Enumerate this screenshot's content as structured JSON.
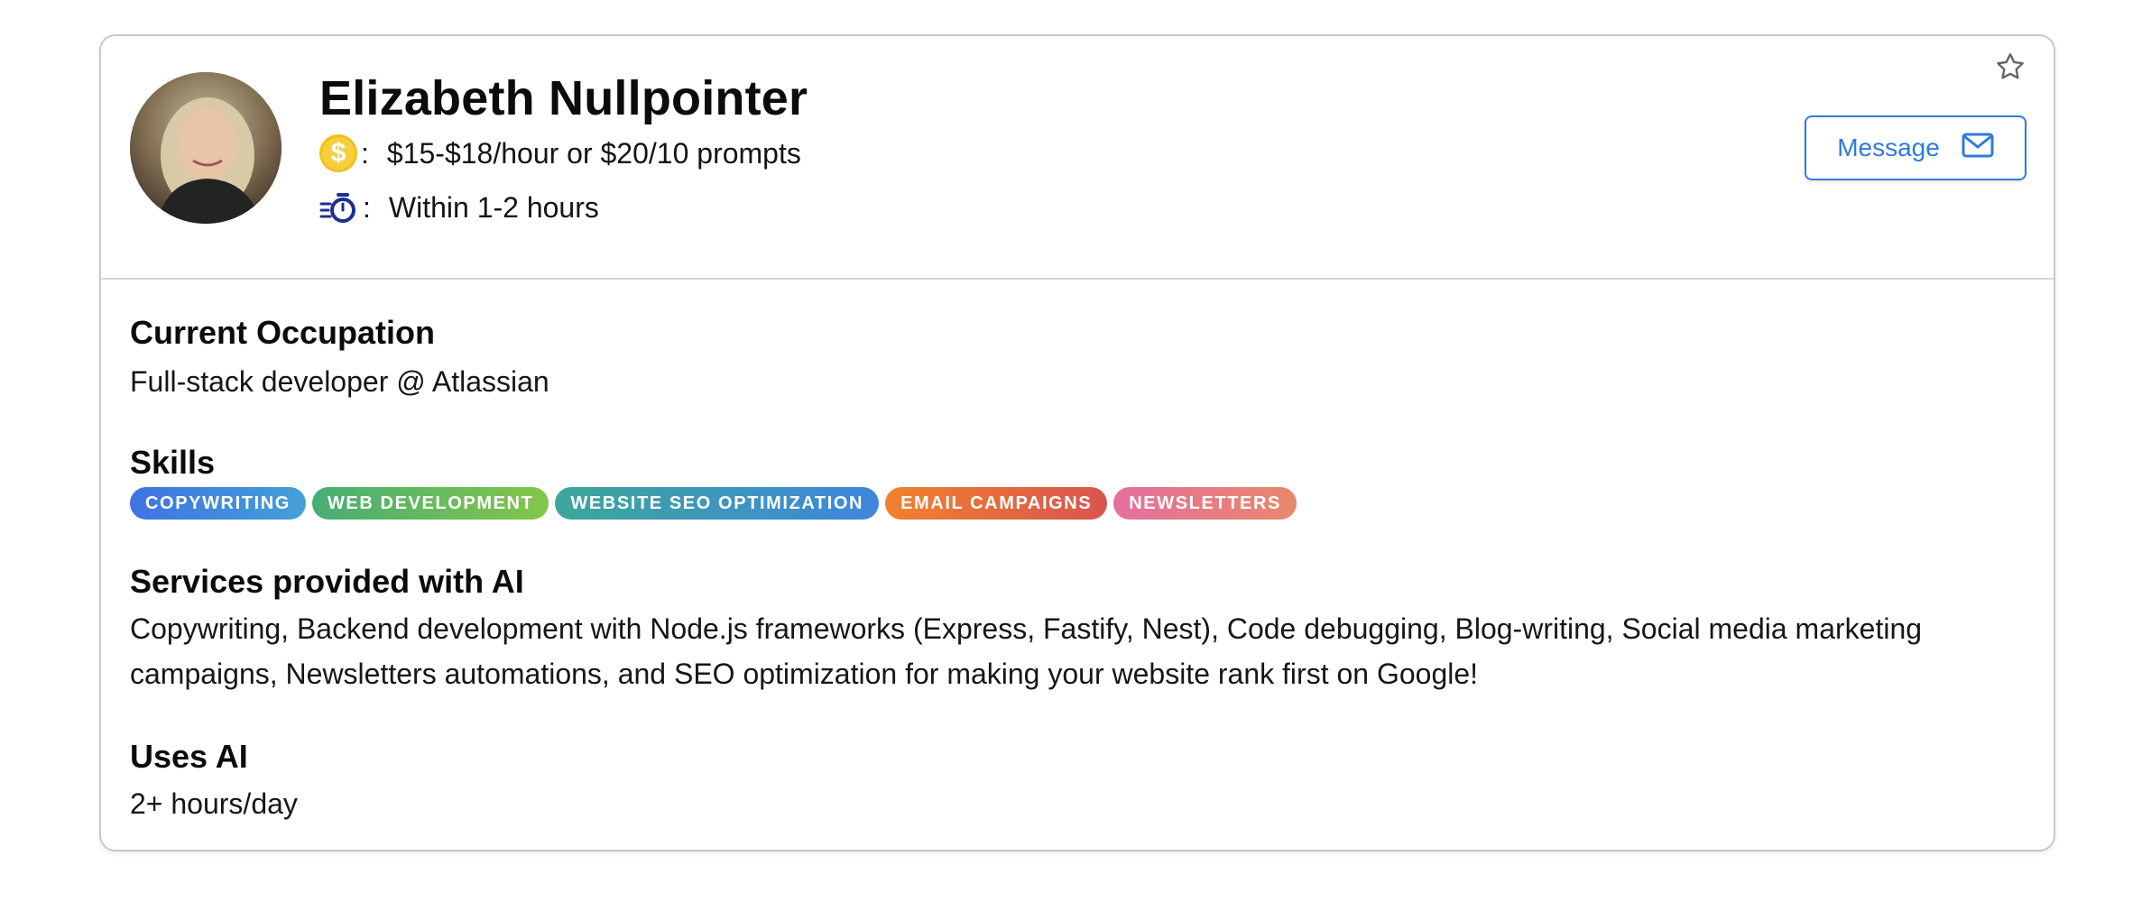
{
  "profile": {
    "name": "Elizabeth Nullpointer",
    "rate_icon": "dollar-coin-icon",
    "rate_colon": ":",
    "rate": "$15-$18/hour or $20/10 prompts",
    "response_icon": "timer-icon",
    "response_colon": ":",
    "response_time": "Within 1-2 hours"
  },
  "actions": {
    "favorite_icon": "star-icon",
    "message_label": "Message",
    "message_icon": "mail-icon"
  },
  "occupation": {
    "title": "Current Occupation",
    "value": "Full-stack developer @ Atlassian"
  },
  "skills": {
    "title": "Skills",
    "items": [
      {
        "label": "COPYWRITING",
        "color_start": "#3e73e2",
        "color_end": "#45a0d8"
      },
      {
        "label": "WEB DEVELOPMENT",
        "color_start": "#47ae74",
        "color_end": "#85c54a"
      },
      {
        "label": "WEBSITE SEO OPTIMIZATION",
        "color_start": "#3da79a",
        "color_end": "#3e86dd"
      },
      {
        "label": "EMAIL CAMPAIGNS",
        "color_start": "#f0822f",
        "color_end": "#d9544f"
      },
      {
        "label": "NEWSLETTERS",
        "color_start": "#e46f9d",
        "color_end": "#e8886b"
      }
    ]
  },
  "services": {
    "title": "Services provided with AI",
    "line1": "Copywriting, Backend development with Node.js frameworks (Express, Fastify, Nest), Code debugging, Blog-writing, Social media marketing",
    "line2": "campaigns, Newsletters automations, and SEO optimization for making your website rank first on Google!"
  },
  "ai_usage": {
    "title": "Uses AI",
    "value": "2+ hours/day"
  },
  "colors": {
    "accent": "#2f7bd8",
    "coin": "#f7cf3c",
    "timer": "#1f2f8f"
  }
}
